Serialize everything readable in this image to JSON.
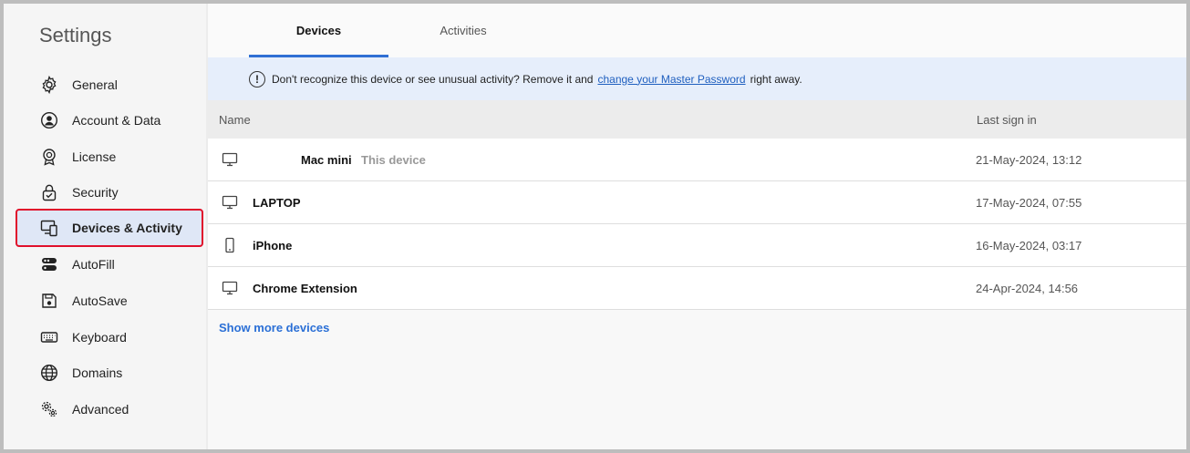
{
  "sidebar": {
    "title": "Settings",
    "items": [
      {
        "label": "General",
        "icon": "gear-icon"
      },
      {
        "label": "Account & Data",
        "icon": "account-icon"
      },
      {
        "label": "License",
        "icon": "license-badge-icon"
      },
      {
        "label": "Security",
        "icon": "lock-icon"
      },
      {
        "label": "Devices & Activity",
        "icon": "devices-icon",
        "active": true
      },
      {
        "label": "AutoFill",
        "icon": "autofill-icon"
      },
      {
        "label": "AutoSave",
        "icon": "save-icon"
      },
      {
        "label": "Keyboard",
        "icon": "keyboard-icon"
      },
      {
        "label": "Domains",
        "icon": "globe-icon"
      },
      {
        "label": "Advanced",
        "icon": "advanced-gears-icon"
      }
    ]
  },
  "tabs": {
    "devices": "Devices",
    "activities": "Activities",
    "active": "Devices"
  },
  "banner": {
    "text_before": "Don't recognize this device or see unusual activity? Remove it and",
    "link": "change your Master Password",
    "text_after": "right away."
  },
  "table": {
    "col_name": "Name",
    "col_last": "Last sign in",
    "rows": [
      {
        "name": "Mac mini",
        "tag": "This device",
        "last": "21-May-2024, 13:12",
        "icon": "desktop-icon"
      },
      {
        "name": "LAPTOP",
        "last": "17-May-2024, 07:55",
        "icon": "desktop-icon"
      },
      {
        "name": "iPhone",
        "last": "16-May-2024, 03:17",
        "icon": "phone-icon"
      },
      {
        "name": "Chrome Extension",
        "last": "24-Apr-2024, 14:56",
        "icon": "desktop-icon"
      }
    ]
  },
  "show_more": "Show more devices",
  "colors": {
    "accent": "#2f6fd4",
    "active_bg": "#dfe7f6",
    "highlight_outline": "#e0102b",
    "banner_bg": "#e6eefb",
    "link": "#1f5fbf"
  }
}
